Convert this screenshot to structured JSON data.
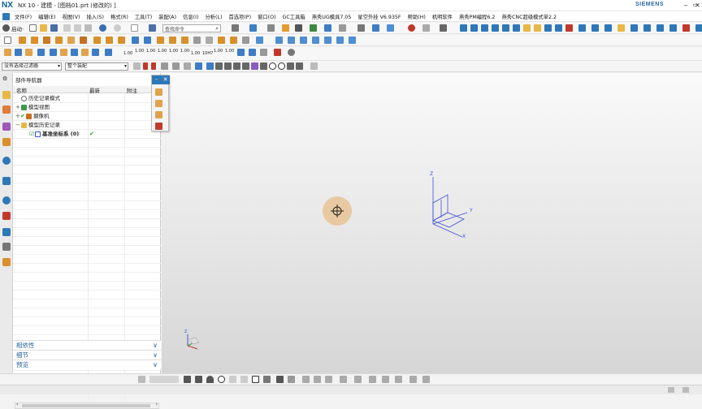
{
  "window": {
    "logo": "NX",
    "title": "NX 10 - 建模 - [图档01.prt  (修改的)  ]",
    "brand": "SIEMENS",
    "controls": [
      "‒",
      "▭",
      "✕"
    ]
  },
  "menu": {
    "items": [
      "文件(F)",
      "编辑(E)",
      "视图(V)",
      "插入(S)",
      "格式(R)",
      "工具(T)",
      "装配(A)",
      "信息(I)",
      "分析(L)",
      "首选项(P)",
      "窗口(O)",
      "GC工具箱",
      "燕秀UG模具7.05",
      "星空外挂 V6.935F",
      "帮助(H)",
      "机明软件",
      "燕秀PM编程6.2",
      "燕秀CNC超级模式单2.2"
    ],
    "start_label": "启动·",
    "search_placeholder": "查找命令"
  },
  "toolbar3": {
    "labels": [
      "1.00",
      "1.00",
      "1.00",
      "1.00",
      "1.00",
      "1.00",
      "1.00",
      "10H7",
      "1.00",
      "1.00"
    ]
  },
  "filter": {
    "selection_filter": "没有选择过滤器",
    "assembly_scope": "整个装配"
  },
  "navigator": {
    "title": "部件导航器",
    "columns": {
      "name": "名称",
      "latest": "最新",
      "note": "附注"
    },
    "rows": [
      {
        "label": "历史记录模式",
        "expander": "",
        "latest": ""
      },
      {
        "label": "模型视图",
        "expander": "+",
        "latest": ""
      },
      {
        "label": "摄像机",
        "expander": "+",
        "latest": ""
      },
      {
        "label": "模型历史记录",
        "expander": "−",
        "latest": ""
      },
      {
        "label": "基准坐标系 (0)",
        "expander": "",
        "latest": "✔"
      }
    ],
    "sections": [
      "相依性",
      "细节",
      "预览"
    ]
  },
  "popup": {
    "buttons": [
      "-",
      "✕"
    ]
  },
  "viewport": {
    "csys_axes": [
      "Z",
      "Y",
      "X"
    ],
    "triad_label": "Z"
  },
  "colors": {
    "accent": "#2f78b8",
    "brand": "#2a6aa6",
    "csys": "#3d4fd6",
    "cursor_halo": "#e8c59a",
    "check": "#2b9b2b"
  }
}
